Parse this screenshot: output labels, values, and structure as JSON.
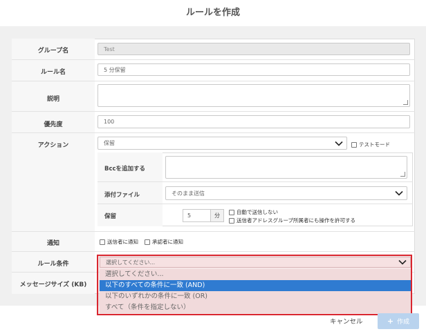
{
  "modal": {
    "title": "ルールを作成"
  },
  "form": {
    "group": {
      "label": "グループ名",
      "value": "Test"
    },
    "rule_name": {
      "label": "ルール名",
      "value": "5 分保留"
    },
    "description": {
      "label": "説明",
      "value": ""
    },
    "priority": {
      "label": "優先度",
      "value": "100"
    },
    "action": {
      "label": "アクション",
      "selected": "保留",
      "test_mode_label": "テストモード",
      "bcc": {
        "label": "Bccを追加する",
        "value": ""
      },
      "attachment": {
        "label": "添付ファイル",
        "selected": "そのまま送信"
      },
      "hold": {
        "label": "保留",
        "value": "5",
        "unit": "分",
        "auto_send_label": "自動で送信しない",
        "permit_label": "送信者アドレスグループ所属者にも操作を許可する"
      }
    },
    "notify": {
      "label": "通知",
      "sender_label": "送信者に通知",
      "approver_label": "承認者に通知"
    },
    "rule_condition": {
      "label": "ルール条件",
      "placeholder": "選択してください...",
      "options": [
        "選択してください...",
        "以下のすべての条件に一致 (AND)",
        "以下のいずれかの条件に一致 (OR)",
        "すべて（条件を指定しない）"
      ],
      "selected_index": 1
    },
    "message_size": {
      "label": "メッセージサイズ (KB)"
    }
  },
  "footer": {
    "cancel_label": "キャンセル",
    "create_label": "作成"
  },
  "colors": {
    "accent": "#2f7bd1",
    "highlight_border": "#d9262f",
    "create_button": "#b9d3ee"
  }
}
